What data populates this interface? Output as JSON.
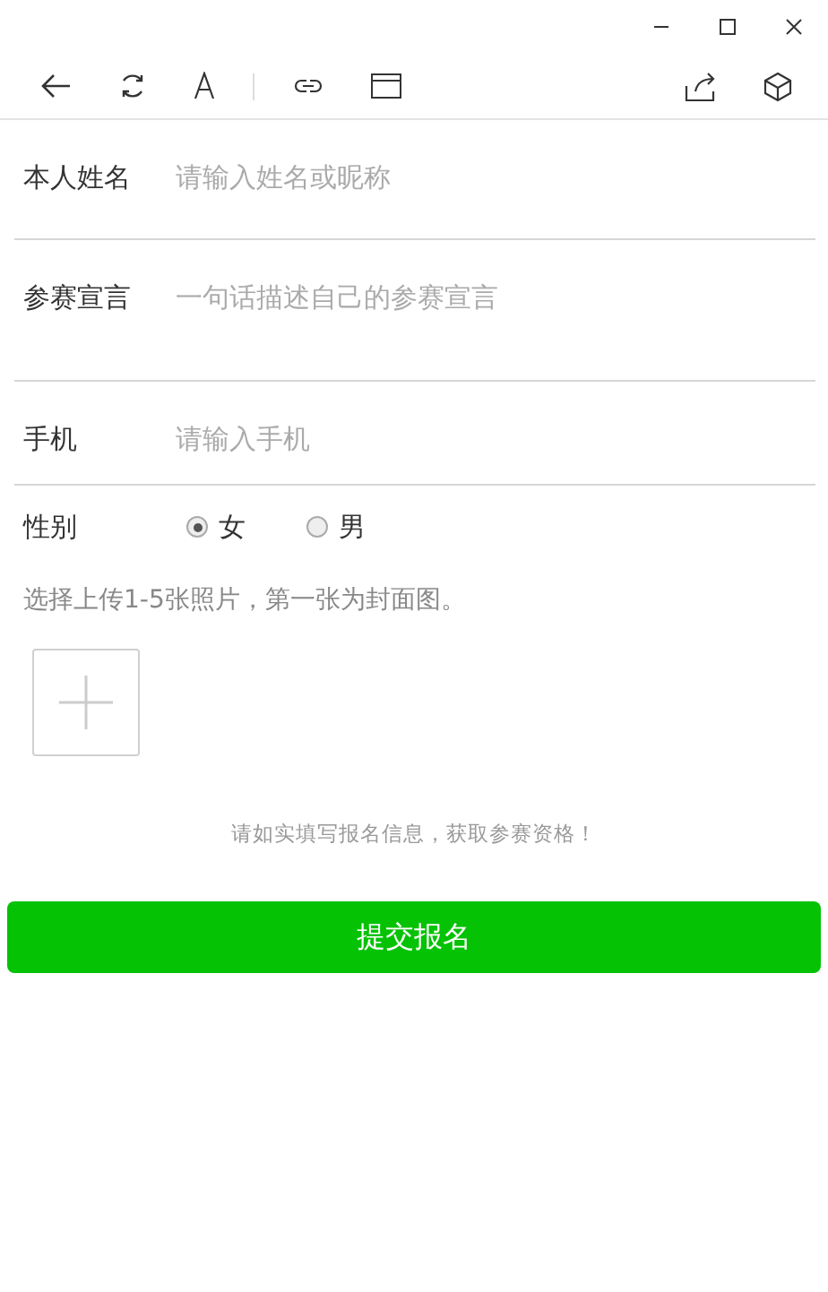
{
  "fields": [
    {
      "kind": "text",
      "label": "本人姓名",
      "placeholder": "请输入姓名或昵称"
    },
    {
      "kind": "textarea",
      "label": "参赛宣言",
      "placeholder": "一句话描述自己的参赛宣言"
    },
    {
      "kind": "text",
      "label": "手机",
      "placeholder": "请输入手机"
    },
    {
      "kind": "radio",
      "label": "性别",
      "options": [
        {
          "label": "女",
          "selected": true
        },
        {
          "label": "男",
          "selected": false
        }
      ]
    }
  ],
  "upload": {
    "hint": "选择上传1-5张照片，第一张为封面图。"
  },
  "notice": "请如实填写报名信息，获取参赛资格！",
  "submit": "提交报名"
}
